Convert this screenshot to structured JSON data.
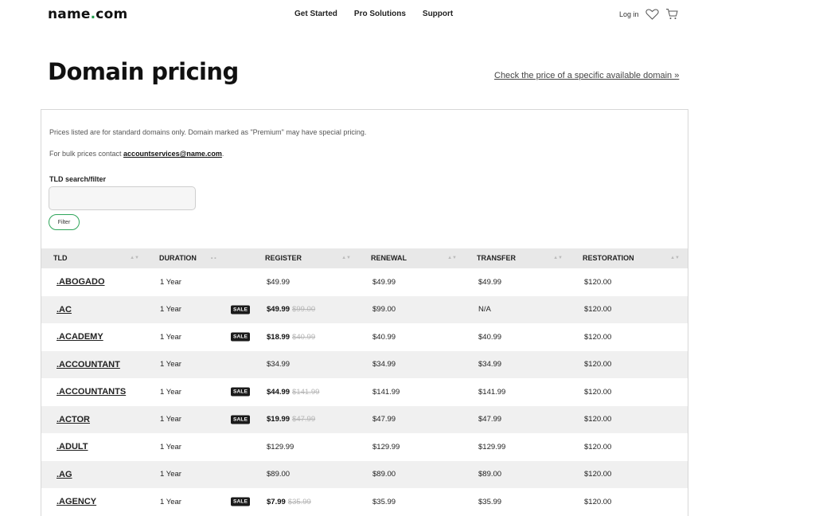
{
  "header": {
    "logo_main": "name",
    "logo_dot": ".",
    "logo_tld": "com",
    "nav": [
      "Get Started",
      "Pro Solutions",
      "Support"
    ],
    "login": "Log in"
  },
  "page": {
    "title": "Domain pricing",
    "check_link": "Check the price of a specific available domain »"
  },
  "panel": {
    "note1": "Prices listed are for standard domains only. Domain marked as \"Premium\" may have special pricing.",
    "note2_prefix": "For bulk prices contact ",
    "note2_email": "accountservices@name.com",
    "note2_suffix": ".",
    "filter_label": "TLD search/filter",
    "filter_value": "",
    "filter_button": "Filter"
  },
  "table": {
    "headers": [
      "TLD",
      "DURATION",
      "REGISTER",
      "RENEWAL",
      "TRANSFER",
      "RESTORATION"
    ],
    "duration_arrows": "- -",
    "sale_badge": "SALE",
    "rows": [
      {
        "tld": ".ABOGADO",
        "duration": "1 Year",
        "sale": false,
        "register": "$49.99",
        "register_old": "",
        "renewal": "$49.99",
        "transfer": "$49.99",
        "restoration": "$120.00"
      },
      {
        "tld": ".AC",
        "duration": "1 Year",
        "sale": true,
        "register": "$49.99",
        "register_old": "$99.00",
        "renewal": "$99.00",
        "transfer": "N/A",
        "restoration": "$120.00"
      },
      {
        "tld": ".ACADEMY",
        "duration": "1 Year",
        "sale": true,
        "register": "$18.99",
        "register_old": "$40.99",
        "renewal": "$40.99",
        "transfer": "$40.99",
        "restoration": "$120.00"
      },
      {
        "tld": ".ACCOUNTANT",
        "duration": "1 Year",
        "sale": false,
        "register": "$34.99",
        "register_old": "",
        "renewal": "$34.99",
        "transfer": "$34.99",
        "restoration": "$120.00"
      },
      {
        "tld": ".ACCOUNTANTS",
        "duration": "1 Year",
        "sale": true,
        "register": "$44.99",
        "register_old": "$141.99",
        "renewal": "$141.99",
        "transfer": "$141.99",
        "restoration": "$120.00"
      },
      {
        "tld": ".ACTOR",
        "duration": "1 Year",
        "sale": true,
        "register": "$19.99",
        "register_old": "$47.99",
        "renewal": "$47.99",
        "transfer": "$47.99",
        "restoration": "$120.00"
      },
      {
        "tld": ".ADULT",
        "duration": "1 Year",
        "sale": false,
        "register": "$129.99",
        "register_old": "",
        "renewal": "$129.99",
        "transfer": "$129.99",
        "restoration": "$120.00"
      },
      {
        "tld": ".AG",
        "duration": "1 Year",
        "sale": false,
        "register": "$89.00",
        "register_old": "",
        "renewal": "$89.00",
        "transfer": "$89.00",
        "restoration": "$120.00"
      },
      {
        "tld": ".AGENCY",
        "duration": "1 Year",
        "sale": true,
        "register": "$7.99",
        "register_old": "$35.99",
        "renewal": "$35.99",
        "transfer": "$35.99",
        "restoration": "$120.00"
      }
    ]
  },
  "icons": [
    "heart-icon",
    "cart-icon",
    "sort-icon"
  ],
  "colors": {
    "accent": "#1e9e4a",
    "header_row": "#e8e8e8",
    "alt_row": "#f0f0f0",
    "sale_badge": "#1b1b1b"
  }
}
